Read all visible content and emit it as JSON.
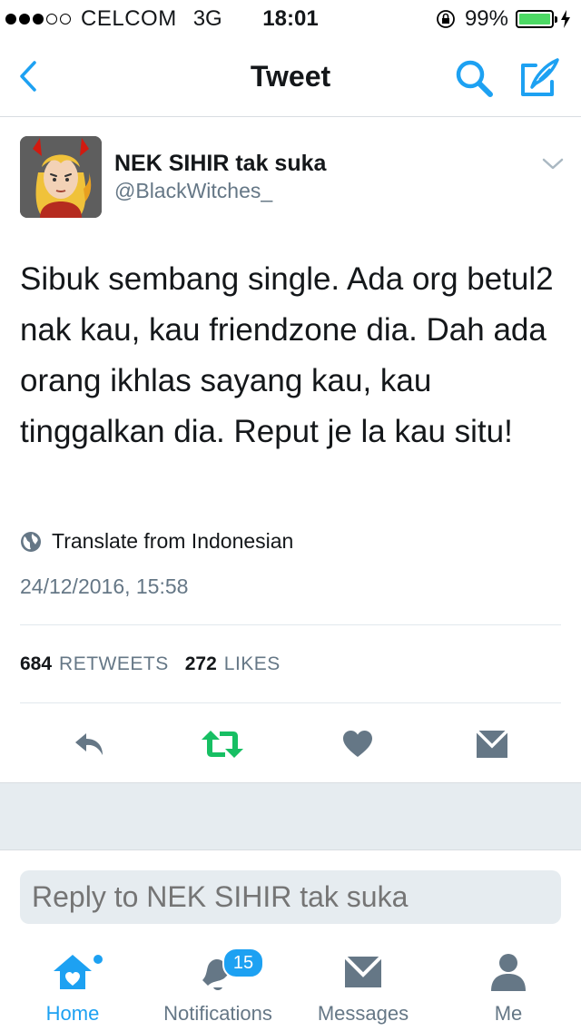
{
  "status_bar": {
    "carrier": "CELCOM",
    "network": "3G",
    "time": "18:01",
    "battery_percent": "99%",
    "battery_level": 0.99,
    "signal_dots_filled": 3,
    "signal_dots_total": 5
  },
  "nav": {
    "title": "Tweet",
    "back_icon": "chevron-left-icon",
    "search_icon": "search-icon",
    "compose_icon": "compose-icon"
  },
  "tweet": {
    "author_name": "NEK SIHIR tak suka",
    "author_handle": "@BlackWitches_",
    "text": "Sibuk sembang single. Ada org betul2 nak kau, kau friendzone dia. Dah ada orang ikhlas sayang kau, kau tinggalkan dia. Reput je la kau situ!",
    "translate_label": "Translate from Indonesian",
    "timestamp": "24/12/2016, 15:58",
    "retweets_count": "684",
    "retweets_label": "RETWEETS",
    "likes_count": "272",
    "likes_label": "LIKES"
  },
  "reply": {
    "placeholder": "Reply to NEK SIHIR tak suka"
  },
  "tabs": [
    {
      "label": "Home",
      "icon": "home-icon"
    },
    {
      "label": "Notifications",
      "icon": "bell-icon",
      "badge": "15"
    },
    {
      "label": "Messages",
      "icon": "envelope-icon"
    },
    {
      "label": "Me",
      "icon": "person-icon"
    }
  ],
  "colors": {
    "accent": "#1da1f2",
    "retweet_green": "#17bf63",
    "muted": "#657786",
    "icon_gray": "#657786",
    "battery_green": "#4cd964",
    "separator_bg": "#e6ecf0"
  }
}
